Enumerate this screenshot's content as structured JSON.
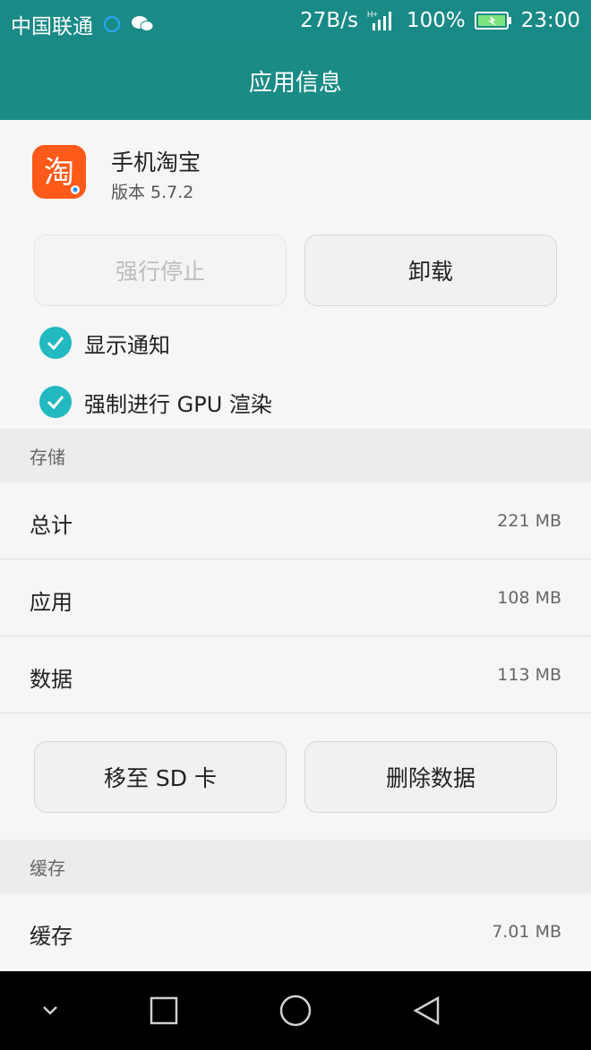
{
  "status_bar": {
    "carrier": "中国联通",
    "network_speed": "27B/s",
    "network_type": "H+",
    "battery_percent": "100%",
    "time": "23:00"
  },
  "title_bar": {
    "title": "应用信息"
  },
  "app": {
    "name": "手机淘宝",
    "version": "版本 5.7.2",
    "icon_char": "淘"
  },
  "actions": {
    "force_stop": "强行停止",
    "uninstall": "卸载"
  },
  "checks": [
    {
      "label": "显示通知",
      "checked": true
    },
    {
      "label": "强制进行 GPU 渲染",
      "checked": true
    }
  ],
  "storage": {
    "header": "存储",
    "rows": [
      {
        "label": "总计",
        "value": "221 MB"
      },
      {
        "label": "应用",
        "value": "108 MB"
      },
      {
        "label": "数据",
        "value": "113 MB"
      }
    ],
    "move_to_sd": "移至 SD 卡",
    "clear_data": "删除数据"
  },
  "cache": {
    "header": "缓存",
    "rows": [
      {
        "label": "缓存",
        "value": "7.01 MB"
      }
    ]
  },
  "colors": {
    "title_bar": "#1b8b86",
    "check_accent": "#22b9c0",
    "app_icon": "#ff5a1a"
  },
  "nav_bar": {
    "icons": [
      "chevron-down-icon",
      "square-icon",
      "circle-icon",
      "triangle-back-icon"
    ]
  }
}
